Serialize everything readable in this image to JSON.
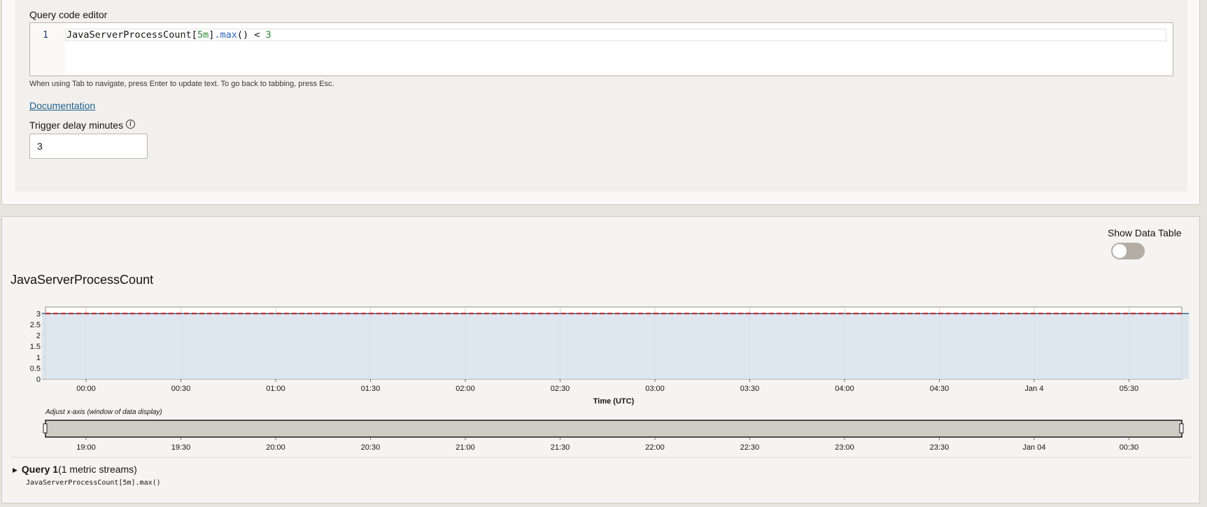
{
  "editor": {
    "label": "Query code editor",
    "line_number": "1",
    "code_tokens": [
      {
        "text": "JavaServerProcessCount[",
        "kind": "plain"
      },
      {
        "text": "5m",
        "kind": "num"
      },
      {
        "text": "]",
        "kind": "plain"
      },
      {
        "text": ".max",
        "kind": "fn"
      },
      {
        "text": "() < ",
        "kind": "plain"
      },
      {
        "text": "3",
        "kind": "num"
      }
    ],
    "hint": "When using Tab to navigate, press Enter to update text. To go back to tabbing, press Esc."
  },
  "documentation_link": "Documentation",
  "trigger_delay": {
    "label": "Trigger delay minutes",
    "value": "3"
  },
  "data_table_toggle": {
    "label": "Show Data Table",
    "on": false
  },
  "chart_title": "JavaServerProcessCount",
  "chart_data": {
    "type": "area",
    "title": "JavaServerProcessCount",
    "xlabel": "Time (UTC)",
    "ylabel": "",
    "yticks": [
      "0",
      "0.5",
      "1",
      "1.5",
      "2",
      "2.5",
      "3"
    ],
    "ylim": [
      0,
      3.3
    ],
    "xticks": [
      "00:00",
      "00:30",
      "01:00",
      "01:30",
      "02:00",
      "02:30",
      "03:00",
      "03:30",
      "04:00",
      "04:30",
      "Jan 4",
      "05:30"
    ],
    "series": [
      {
        "values_constant": 3,
        "start": "23:46",
        "end": "05:49"
      }
    ],
    "threshold": 3,
    "grid": true,
    "slider": {
      "caption": "Adjust x-axis (window of data display)",
      "ticks": [
        "19:00",
        "19:30",
        "20:00",
        "20:30",
        "21:00",
        "21:30",
        "22:00",
        "22:30",
        "23:00",
        "23:30",
        "Jan 04",
        "00:30"
      ]
    }
  },
  "query": {
    "name": "Query 1",
    "streams": "(1 metric streams)",
    "code": "JavaServerProcessCount[5m].max()"
  },
  "colors": {
    "area_fill": "#d8e3ec",
    "line": "#3b6a91",
    "threshold": "#c0161a",
    "slider_fill": "#cfccc6"
  }
}
